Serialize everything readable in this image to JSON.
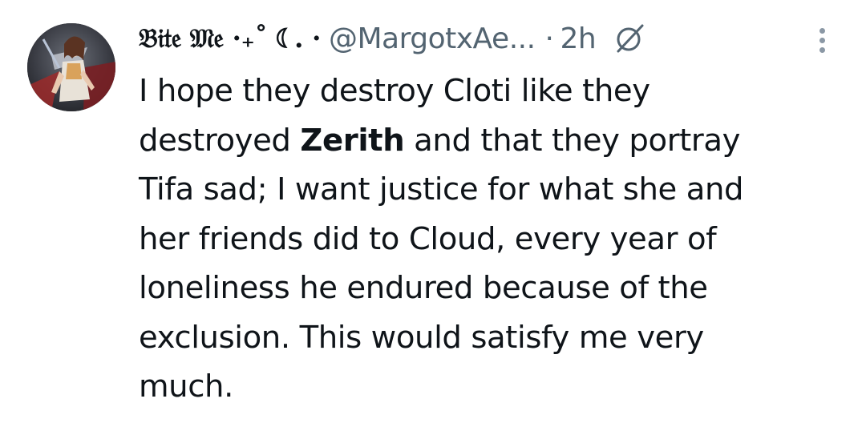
{
  "tweet": {
    "author": {
      "display_name": "𝔅𝔦𝔱𝔢 𝔐𝔢 ·₊˚ ☾. ·",
      "handle": "@MargotxAe...",
      "avatar_icon": "profile-avatar"
    },
    "separator": "·",
    "time": "2h",
    "badge_icon": "slashed-circle-icon",
    "more_icon": "more-options-icon",
    "text_lines": [
      {
        "pre": "I hope they destroy Cloti  like they",
        "bold": "",
        "post": ""
      },
      {
        "pre": "destroyed ",
        "bold": "Zerith",
        "post": " and that they portray"
      },
      {
        "pre": "Tifa sad; I want justice for what she and",
        "bold": "",
        "post": ""
      },
      {
        "pre": "her friends did to Cloud, every year of",
        "bold": "",
        "post": ""
      },
      {
        "pre": "loneliness he endured because of the",
        "bold": "",
        "post": ""
      },
      {
        "pre": "exclusion. This would satisfy me very",
        "bold": "",
        "post": ""
      },
      {
        "pre": "much.",
        "bold": "",
        "post": ""
      }
    ]
  },
  "colors": {
    "text": "#0f1419",
    "secondary": "#536471",
    "background": "#ffffff"
  }
}
